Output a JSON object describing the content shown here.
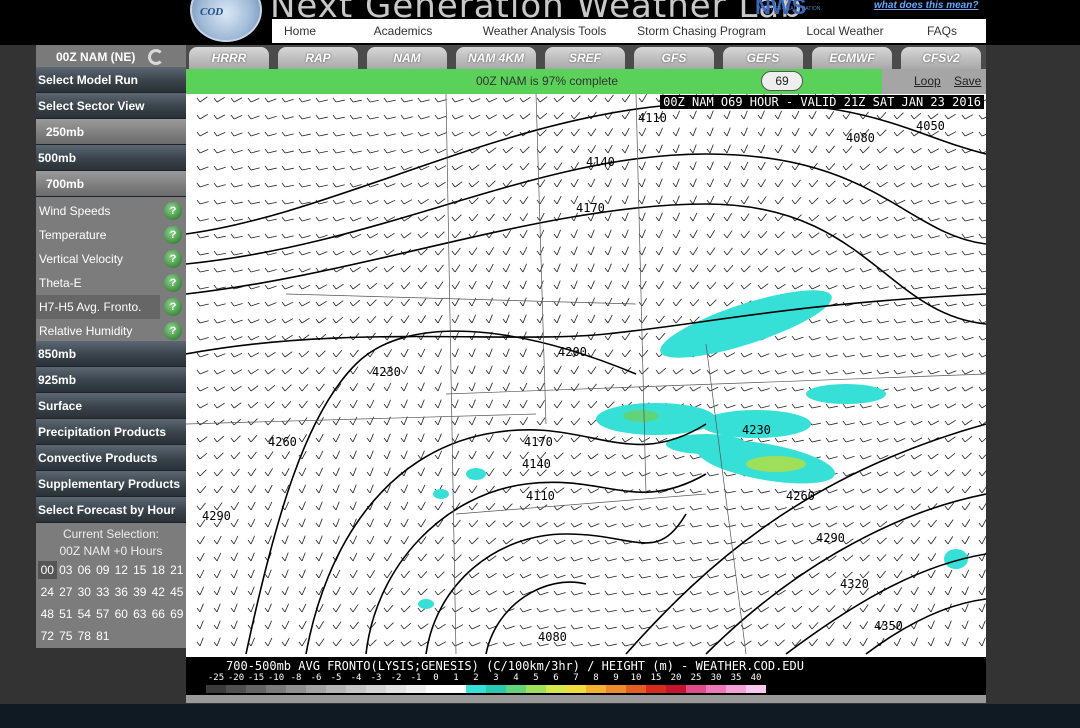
{
  "header": {
    "logo_text": "COD",
    "site_title": "Next Generation Weather Lab",
    "nws_logo": "NWS",
    "nws_sub": "WEATHER-READY NATION",
    "help_link": "what does this mean?"
  },
  "nav": [
    "Home",
    "Academics",
    "Weather Analysis Tools",
    "Storm Chasing Program",
    "Local Weather",
    "FAQs"
  ],
  "sidebar": {
    "model_title": "00Z NAM (NE)",
    "select_model_run": "Select Model Run",
    "select_sector": "Select Sector View",
    "levels": [
      "250mb",
      "500mb",
      "700mb"
    ],
    "products_700": [
      "Wind Speeds",
      "Temperature",
      "Vertical Velocity",
      "Theta-E",
      "H7-H5 Avg. Fronto.",
      "Relative Humidity"
    ],
    "sections": [
      "850mb",
      "925mb",
      "Surface",
      "Precipitation Products",
      "Convective Products",
      "Supplementary Products",
      "Select Forecast by Hour"
    ],
    "current_selection_label": "Current Selection:",
    "current_selection_value": "00Z NAM +0 Hours",
    "hours": [
      "00",
      "03",
      "06",
      "09",
      "12",
      "15",
      "18",
      "21",
      "24",
      "27",
      "30",
      "33",
      "36",
      "39",
      "42",
      "45",
      "48",
      "51",
      "54",
      "57",
      "60",
      "63",
      "66",
      "69",
      "72",
      "75",
      "78",
      "81"
    ]
  },
  "tabs": [
    "HRRR",
    "RAP",
    "NAM",
    "NAM 4KM",
    "SREF",
    "GFS",
    "GEFS",
    "ECMWF",
    "CFSv2"
  ],
  "progress": {
    "text": "00Z NAM is 97% complete",
    "percent": 87,
    "hour_value": "69",
    "loop": "Loop",
    "save": "Save"
  },
  "map": {
    "title": "00Z NAM O69 HOUR - VALID 21Z SAT JAN 23 2016",
    "legend_title": "700-500mb AVG FRONTO(LYSIS;GENESIS) (C/100km/3hr) / HEIGHT (m) -  WEATHER.COD.EDU",
    "legend_values": [
      "-25",
      "-20",
      "-15",
      "-10",
      "-8",
      "-6",
      "-5",
      "-4",
      "-3",
      "-2",
      "-1",
      "0",
      "1",
      "2",
      "3",
      "4",
      "5",
      "6",
      "7",
      "8",
      "9",
      "10",
      "15",
      "20",
      "25",
      "30",
      "35",
      "40"
    ],
    "legend_colors": [
      "#3a3a3a",
      "#4f4f4f",
      "#646464",
      "#7a7a7a",
      "#8f8f8f",
      "#a3a3a3",
      "#b5b5b5",
      "#c5c5c5",
      "#d4d4d4",
      "#e2e2e2",
      "#efefef",
      "#ffffff",
      "#ffffff",
      "#36e0d6",
      "#29c9b0",
      "#5fd47a",
      "#9ee05a",
      "#d6e84e",
      "#f0dc3c",
      "#f4b030",
      "#ee8a2a",
      "#e45e22",
      "#d62c1e",
      "#c41430",
      "#e04c8a",
      "#ee78b8",
      "#f6a0d8",
      "#fbc8ee"
    ],
    "contour_labels": [
      "4110",
      "4050",
      "4080",
      "4140",
      "4170",
      "4200",
      "4230",
      "4260",
      "4290",
      "4170",
      "4140",
      "4110",
      "4230",
      "4260",
      "4290",
      "4320",
      "4350",
      "4080"
    ]
  },
  "colors": {
    "accent_green": "#5ad25a",
    "sidebar_dark": "#3a434b",
    "link_blue": "#6aa6ff"
  }
}
